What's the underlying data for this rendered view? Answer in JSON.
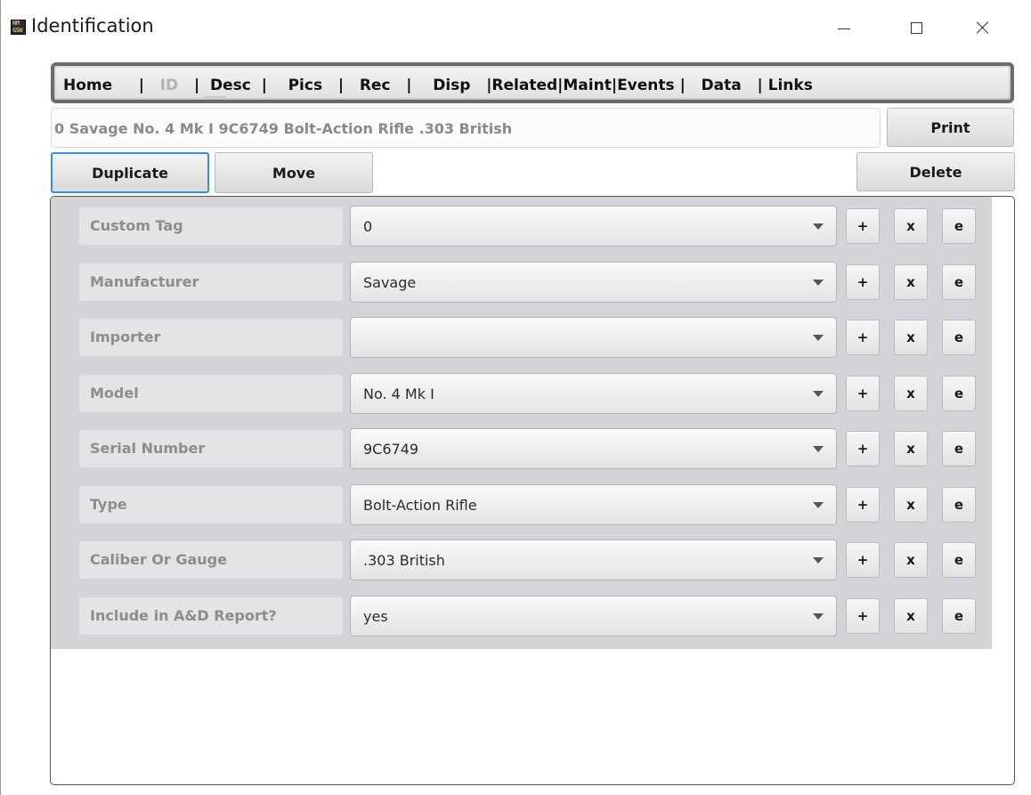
{
  "window": {
    "title": "Identification",
    "icon_name": "nm-app-icon",
    "icon_text_top": "NM",
    "icon_text_bottom": "GSW"
  },
  "nav": {
    "tabs": [
      {
        "label": "Home",
        "enabled": true
      },
      {
        "label": "ID",
        "enabled": false
      },
      {
        "label": "Desc",
        "enabled": true
      },
      {
        "label": "Pics",
        "enabled": true
      },
      {
        "label": "Rec",
        "enabled": true
      },
      {
        "label": "Disp",
        "enabled": true
      },
      {
        "label": "Related",
        "enabled": true
      },
      {
        "label": "Maint",
        "enabled": true
      },
      {
        "label": "Events",
        "enabled": true
      },
      {
        "label": "Data",
        "enabled": true
      },
      {
        "label": "Links",
        "enabled": true
      }
    ],
    "separator": "|"
  },
  "summary": {
    "text": "0 Savage  No. 4 Mk I 9C6749 Bolt-Action Rifle .303 British"
  },
  "toolbar": {
    "print_label": "Print",
    "duplicate_label": "Duplicate",
    "move_label": "Move",
    "delete_label": "Delete"
  },
  "fields": [
    {
      "label": "Custom Tag",
      "value": "0"
    },
    {
      "label": "Manufacturer",
      "value": "Savage"
    },
    {
      "label": "Importer",
      "value": ""
    },
    {
      "label": "Model",
      "value": "No. 4 Mk I"
    },
    {
      "label": "Serial Number",
      "value": "9C6749"
    },
    {
      "label": "Type",
      "value": "Bolt-Action Rifle"
    },
    {
      "label": "Caliber Or Gauge",
      "value": ".303 British"
    },
    {
      "label": "Include in A&D Report?",
      "value": "yes"
    }
  ],
  "field_buttons": {
    "add": "+",
    "clear": "x",
    "edit": "e"
  },
  "colors": {
    "accent": "#3b8fd6",
    "nav_border": "#6f6a6a",
    "form_background": "#d4d3d8"
  }
}
